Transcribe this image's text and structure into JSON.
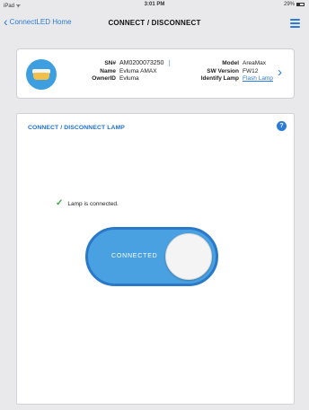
{
  "status_bar": {
    "carrier": "iPad ᯤ",
    "time": "3:01 PM",
    "battery": "29%"
  },
  "nav": {
    "back_label": "ConnectLED Home",
    "title": "CONNECT / DISCONNECT"
  },
  "lamp": {
    "sn_label": "SN#",
    "sn_value": "AM0200073250",
    "name_label": "Name",
    "name_value": "Evluma AMAX",
    "owner_label": "OwnerID",
    "owner_value": "Evluma",
    "model_label": "Model",
    "model_value": "AreaMax",
    "sw_label": "SW Version",
    "sw_value": "FW12",
    "identify_label": "Identify Lamp",
    "identify_link": "Flash Lamp"
  },
  "panel": {
    "title": "CONNECT / DISCONNECT LAMP",
    "help": "?",
    "status_message": "Lamp is connected.",
    "toggle_label": "CONNECTED",
    "toggle_on": true
  },
  "colors": {
    "accent": "#2b7bd8",
    "toggle": "#4aa1e2",
    "success": "#3aa845"
  }
}
